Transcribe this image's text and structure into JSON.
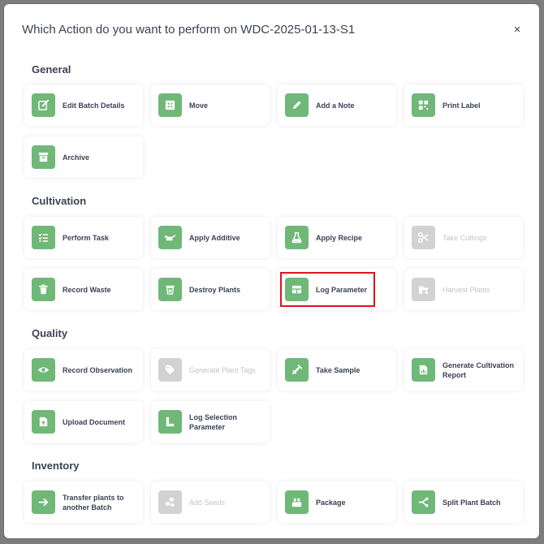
{
  "modal": {
    "title": "Which Action do you want to perform on WDC-2025-01-13-S1",
    "close_label": "×"
  },
  "sections": {
    "general": "General",
    "cultivation": "Cultivation",
    "quality": "Quality",
    "inventory": "Inventory"
  },
  "actions": {
    "edit_batch_details": "Edit Batch Details",
    "move": "Move",
    "add_note": "Add a Note",
    "print_label": "Print Label",
    "archive": "Archive",
    "perform_task": "Perform Task",
    "apply_additive": "Apply Additive",
    "apply_recipe": "Apply Recipe",
    "take_cuttings": "Take Cuttings",
    "record_waste": "Record Waste",
    "destroy_plants": "Destroy Plants",
    "log_parameter": "Log Parameter",
    "harvest_plants": "Harvest Plants",
    "record_observation": "Record Observation",
    "generate_plant_tags": "Generate Plant Tags",
    "take_sample": "Take Sample",
    "generate_cultivation_report": "Generate Cultivation Report",
    "upload_document": "Upload Document",
    "log_selection_parameter": "Log Selection Parameter",
    "transfer_plants": "Transfer plants to another Batch",
    "add_seeds": "Add Seeds",
    "package": "Package",
    "split_plant_batch": "Split Plant Batch"
  },
  "colors": {
    "accent": "#6fb877",
    "disabled": "#d2d2d2",
    "highlight": "#e0141d"
  }
}
